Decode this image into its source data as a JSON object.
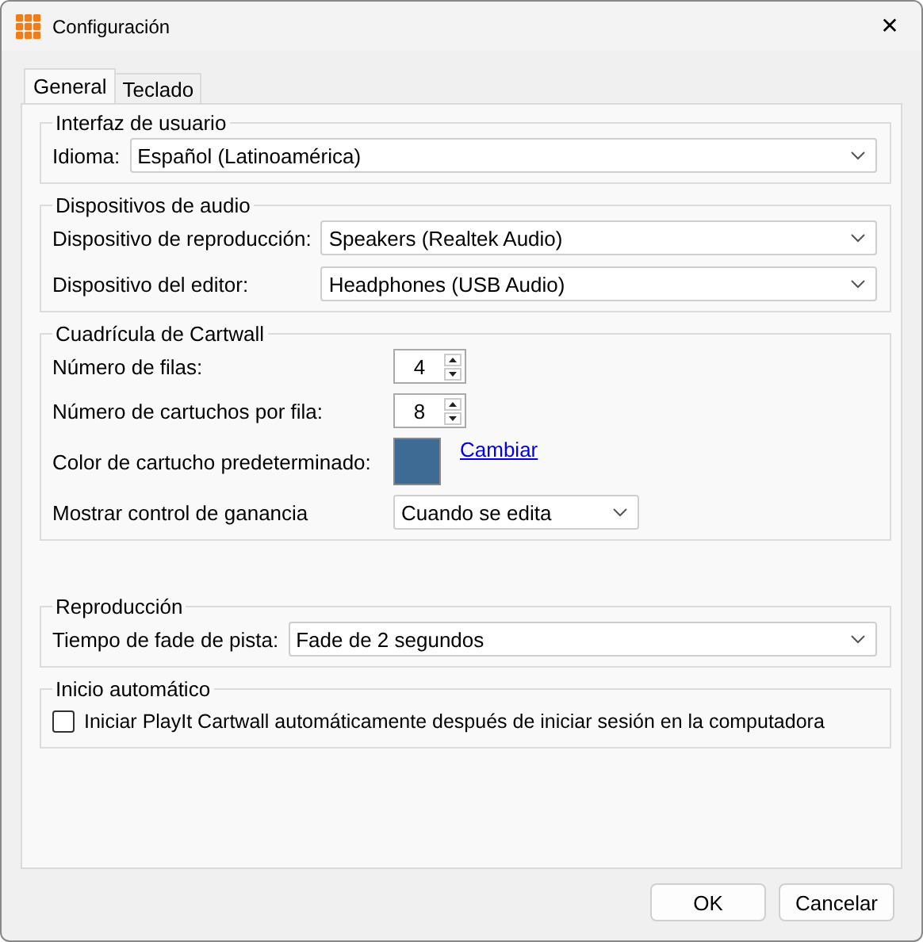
{
  "window": {
    "title": "Configuración",
    "close": "✕"
  },
  "tabs": [
    {
      "label": "General",
      "selected": true
    },
    {
      "label": "Teclado",
      "selected": false
    }
  ],
  "groups": [
    {
      "title": "Interfaz de usuario",
      "rows": [
        {
          "kind": "select",
          "label": "Idioma:",
          "value": "Español (Latinoamérica)"
        }
      ]
    },
    {
      "title": "Dispositivos de audio",
      "rows": [
        {
          "kind": "select",
          "label": "Dispositivo de reproducción:",
          "value": "Speakers (Realtek Audio)"
        },
        {
          "kind": "select",
          "label": "Dispositivo del editor:",
          "value": "Headphones (USB Audio)"
        }
      ]
    },
    {
      "title": "Cuadrícula de Cartwall",
      "rows": [
        {
          "kind": "spinner",
          "label": "Número de filas:",
          "value": "4"
        },
        {
          "kind": "spinner",
          "label": "Número de cartuchos por fila:",
          "value": "8"
        },
        {
          "kind": "color",
          "label": "Color de cartucho predeterminado:",
          "color": "#3d6b94",
          "link": "Cambiar"
        },
        {
          "kind": "select",
          "label": "Mostrar control de ganancia",
          "value": "Cuando se edita"
        }
      ]
    },
    {
      "title": "Reproducción",
      "rows": [
        {
          "kind": "select",
          "label": "Tiempo de fade de pista:",
          "value": "Fade de 2 segundos"
        }
      ]
    },
    {
      "title": "Inicio automático",
      "rows": [
        {
          "kind": "checkbox",
          "label": "Iniciar PlayIt Cartwall automáticamente después de iniciar sesión en la computadora",
          "checked": false
        }
      ]
    }
  ],
  "buttons": [
    "OK",
    "Cancelar"
  ]
}
